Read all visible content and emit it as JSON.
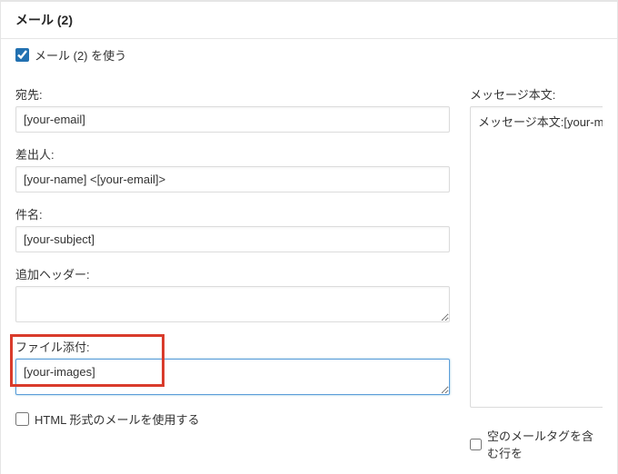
{
  "panel": {
    "title": "メール (2)"
  },
  "useMail2": {
    "label": "メール (2) を使う",
    "checked": true
  },
  "fields": {
    "to": {
      "label": "宛先:",
      "value": "[your-email]"
    },
    "from": {
      "label": "差出人:",
      "value": "[your-name] <[your-email]>"
    },
    "subject": {
      "label": "件名:",
      "value": "[your-subject]"
    },
    "headers": {
      "label": "追加ヘッダー:",
      "value": ""
    },
    "attachment": {
      "label": "ファイル添付:",
      "value": "[your-images]"
    },
    "body": {
      "label": "メッセージ本文:",
      "value": "メッセージ本文:[your-me"
    }
  },
  "options": {
    "useHtml": {
      "label": "HTML 形式のメールを使用する",
      "checked": false
    },
    "excludeBlank": {
      "label": "空のメールタグを含む行を",
      "checked": false
    }
  }
}
